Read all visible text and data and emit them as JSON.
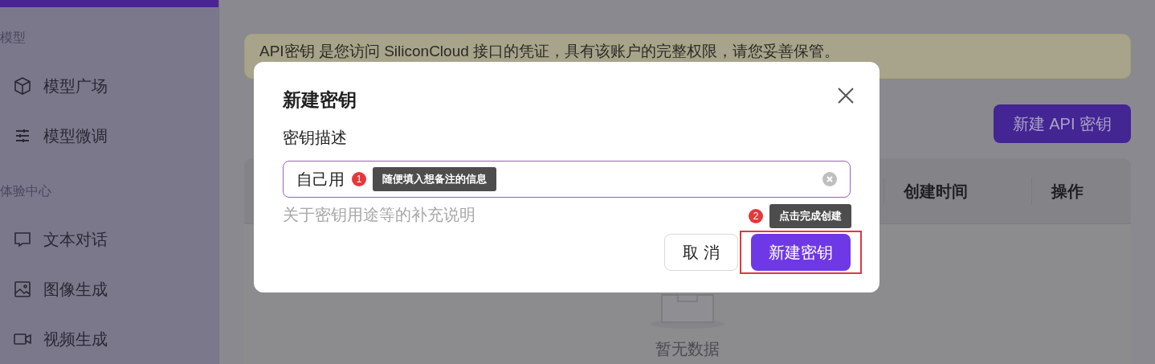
{
  "sidebar": {
    "sections": [
      {
        "title": "模型",
        "items": [
          {
            "label": "模型广场"
          },
          {
            "label": "模型微调"
          }
        ]
      },
      {
        "title": "体验中心",
        "items": [
          {
            "label": "文本对话"
          },
          {
            "label": "图像生成"
          },
          {
            "label": "视频生成"
          }
        ]
      }
    ]
  },
  "notice": {
    "text": "API密钥 是您访问 SiliconCloud 接口的凭证，具有该账户的完整权限，请您妥善保管。"
  },
  "new_key_button": {
    "label": "新建 API 密钥"
  },
  "table": {
    "columns": [
      "创建时间",
      "操作"
    ],
    "empty_text": "暂无数据"
  },
  "dialog": {
    "title": "新建密钥",
    "field_label": "密钥描述",
    "input": {
      "value": "自己用"
    },
    "help": "关于密钥用途等的补充说明",
    "buttons": [
      {
        "label": "取 消",
        "kind": "secondary"
      },
      {
        "label": "新建密钥",
        "kind": "primary",
        "highlighted": true
      }
    ]
  },
  "annotations": [
    {
      "number": "1",
      "text": "随便填入想备注的信息"
    },
    {
      "number": "2",
      "text": "点击完成创建"
    }
  ]
}
